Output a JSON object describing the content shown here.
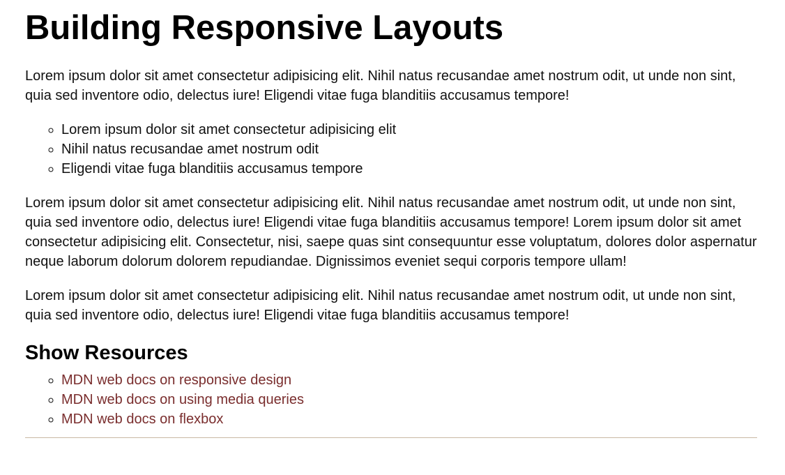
{
  "article": {
    "title": "Building Responsive Layouts",
    "paragraph_1": "Lorem ipsum dolor sit amet consectetur adipisicing elit. Nihil natus recusandae amet nostrum odit, ut unde non sint, quia sed inventore odio, delectus iure! Eligendi vitae fuga blanditiis accusamus tempore!",
    "bullets": [
      "Lorem ipsum dolor sit amet consectetur adipisicing elit",
      "Nihil natus recusandae amet nostrum odit",
      "Eligendi vitae fuga blanditiis accusamus tempore"
    ],
    "paragraph_2": "Lorem ipsum dolor sit amet consectetur adipisicing elit. Nihil natus recusandae amet nostrum odit, ut unde non sint, quia sed inventore odio, delectus iure! Eligendi vitae fuga blanditiis accusamus tempore! Lorem ipsum dolor sit amet consectetur adipisicing elit. Consectetur, nisi, saepe quas sint consequuntur esse voluptatum, dolores dolor aspernatur neque laborum dolorum dolorem repudiandae. Dignissimos eveniet sequi corporis tempore ullam!",
    "paragraph_3": "Lorem ipsum dolor sit amet consectetur adipisicing elit. Nihil natus recusandae amet nostrum odit, ut unde non sint, quia sed inventore odio, delectus iure! Eligendi vitae fuga blanditiis accusamus tempore!"
  },
  "resources": {
    "heading": "Show Resources",
    "links": [
      "MDN web docs on responsive design",
      "MDN web docs on using media queries",
      "MDN web docs on flexbox"
    ]
  },
  "colors": {
    "link": "#7a2e2e",
    "divider": "#c9b8a3",
    "text": "#111111"
  }
}
